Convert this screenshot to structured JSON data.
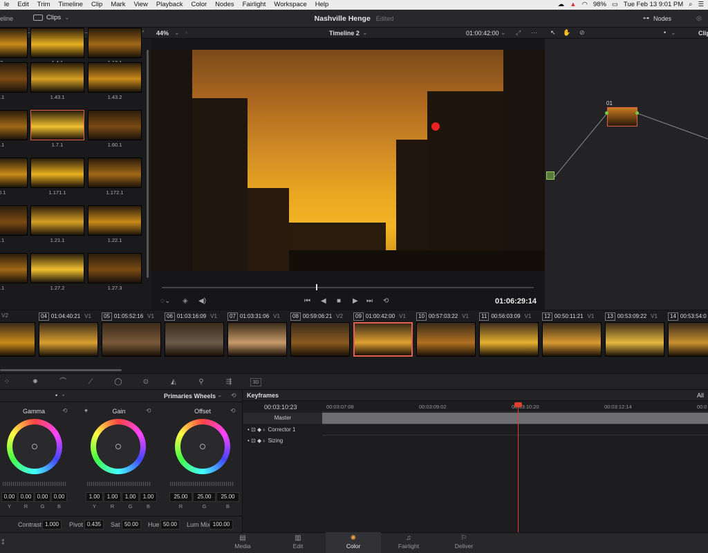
{
  "menubar": {
    "items": [
      "le",
      "Edit",
      "Trim",
      "Timeline",
      "Clip",
      "Mark",
      "View",
      "Playback",
      "Color",
      "Nodes",
      "Fairlight",
      "Workspace",
      "Help"
    ],
    "battery": "98%",
    "clock": "Tue Feb 13  9:01 PM"
  },
  "topbar": {
    "left_label": "eline",
    "clips_label": "Clips",
    "project_title": "Nashville Henge",
    "edited_label": "Edited",
    "nodes_label": "Nodes",
    "right_label": "Clip"
  },
  "viewer": {
    "zoom": "44%",
    "timeline_name": "Timeline 2",
    "timecode_top": "01:00:42:00",
    "timecode_playhead": "01:06:29:14"
  },
  "media_pool": {
    "thumbs": [
      {
        "label": ".2"
      },
      {
        "label": "1.4.1"
      },
      {
        "label": "1.13.1"
      },
      {
        "label": "2.1"
      },
      {
        "label": "1.43.1"
      },
      {
        "label": "1.43.2"
      },
      {
        "label": "2.1"
      },
      {
        "label": "1.7.1"
      },
      {
        "label": "1.60.1"
      },
      {
        "label": "70.1"
      },
      {
        "label": "1.171.1"
      },
      {
        "label": "1.172.1"
      },
      {
        "label": "0.1"
      },
      {
        "label": "1.21.1"
      },
      {
        "label": "1.22.1"
      },
      {
        "label": "7.1"
      },
      {
        "label": "1.27.2"
      },
      {
        "label": "1.27.3"
      }
    ]
  },
  "node": {
    "id": "01"
  },
  "timeline_clips": [
    {
      "num": "",
      "tc": "58:39:07",
      "track": "V2"
    },
    {
      "num": "04",
      "tc": "01:04:40:21",
      "track": "V1"
    },
    {
      "num": "05",
      "tc": "01:05:52:16",
      "track": "V1"
    },
    {
      "num": "06",
      "tc": "01:03:16:09",
      "track": "V1"
    },
    {
      "num": "07",
      "tc": "01:03:31:06",
      "track": "V1"
    },
    {
      "num": "08",
      "tc": "00:59:06:21",
      "track": "V2"
    },
    {
      "num": "09",
      "tc": "01:00:42:00",
      "track": "V1"
    },
    {
      "num": "10",
      "tc": "00:57:03:22",
      "track": "V1"
    },
    {
      "num": "11",
      "tc": "00:56:03:09",
      "track": "V1"
    },
    {
      "num": "12",
      "tc": "00:50:11:21",
      "track": "V1"
    },
    {
      "num": "13",
      "tc": "00:53:09:22",
      "track": "V1"
    },
    {
      "num": "14",
      "tc": "00:53:54:0",
      "track": ""
    }
  ],
  "tools": {
    "label_3d": "3D"
  },
  "wheels": {
    "mode": "Primaries Wheels",
    "gamma": {
      "label": "Gamma",
      "values": [
        "0.00",
        "0.00",
        "0.00",
        "0.00"
      ],
      "channels": [
        "Y",
        "R",
        "G",
        "B"
      ]
    },
    "gain": {
      "label": "Gain",
      "values": [
        "1.00",
        "1.00",
        "1.00",
        "1.00"
      ],
      "channels": [
        "Y",
        "R",
        "G",
        "B"
      ]
    },
    "offset": {
      "label": "Offset",
      "values": [
        "25.00",
        "25.00",
        "25.00"
      ],
      "channels": [
        "R",
        "G",
        "B"
      ]
    },
    "bottom": {
      "contrast_label": "Contrast",
      "contrast": "1.000",
      "pivot_label": "Pivot",
      "pivot": "0.435",
      "sat_label": "Sat",
      "sat": "50.00",
      "hue_label": "Hue",
      "hue": "50.00",
      "lummix_label": "Lum Mix",
      "lummix": "100.00"
    }
  },
  "keyframes": {
    "title": "Keyframes",
    "filter": "All",
    "current_tc": "00:03:10:23",
    "ruler": [
      "00:03:07:08",
      "00:03:09:02",
      "00:03:10:20",
      "00:03:12:14",
      "00:0"
    ],
    "rows": [
      "Master",
      "Corrector 1",
      "Sizing"
    ]
  },
  "pages": [
    {
      "label": "Media",
      "icon": "media-icon"
    },
    {
      "label": "Edit",
      "icon": "edit-icon"
    },
    {
      "label": "Color",
      "icon": "color-icon",
      "active": true
    },
    {
      "label": "Fairlight",
      "icon": "fairlight-icon"
    },
    {
      "label": "Deliver",
      "icon": "deliver-icon"
    }
  ],
  "colors": {
    "accent": "#e0604e",
    "panel": "#232326",
    "amber": "#f3b424"
  }
}
